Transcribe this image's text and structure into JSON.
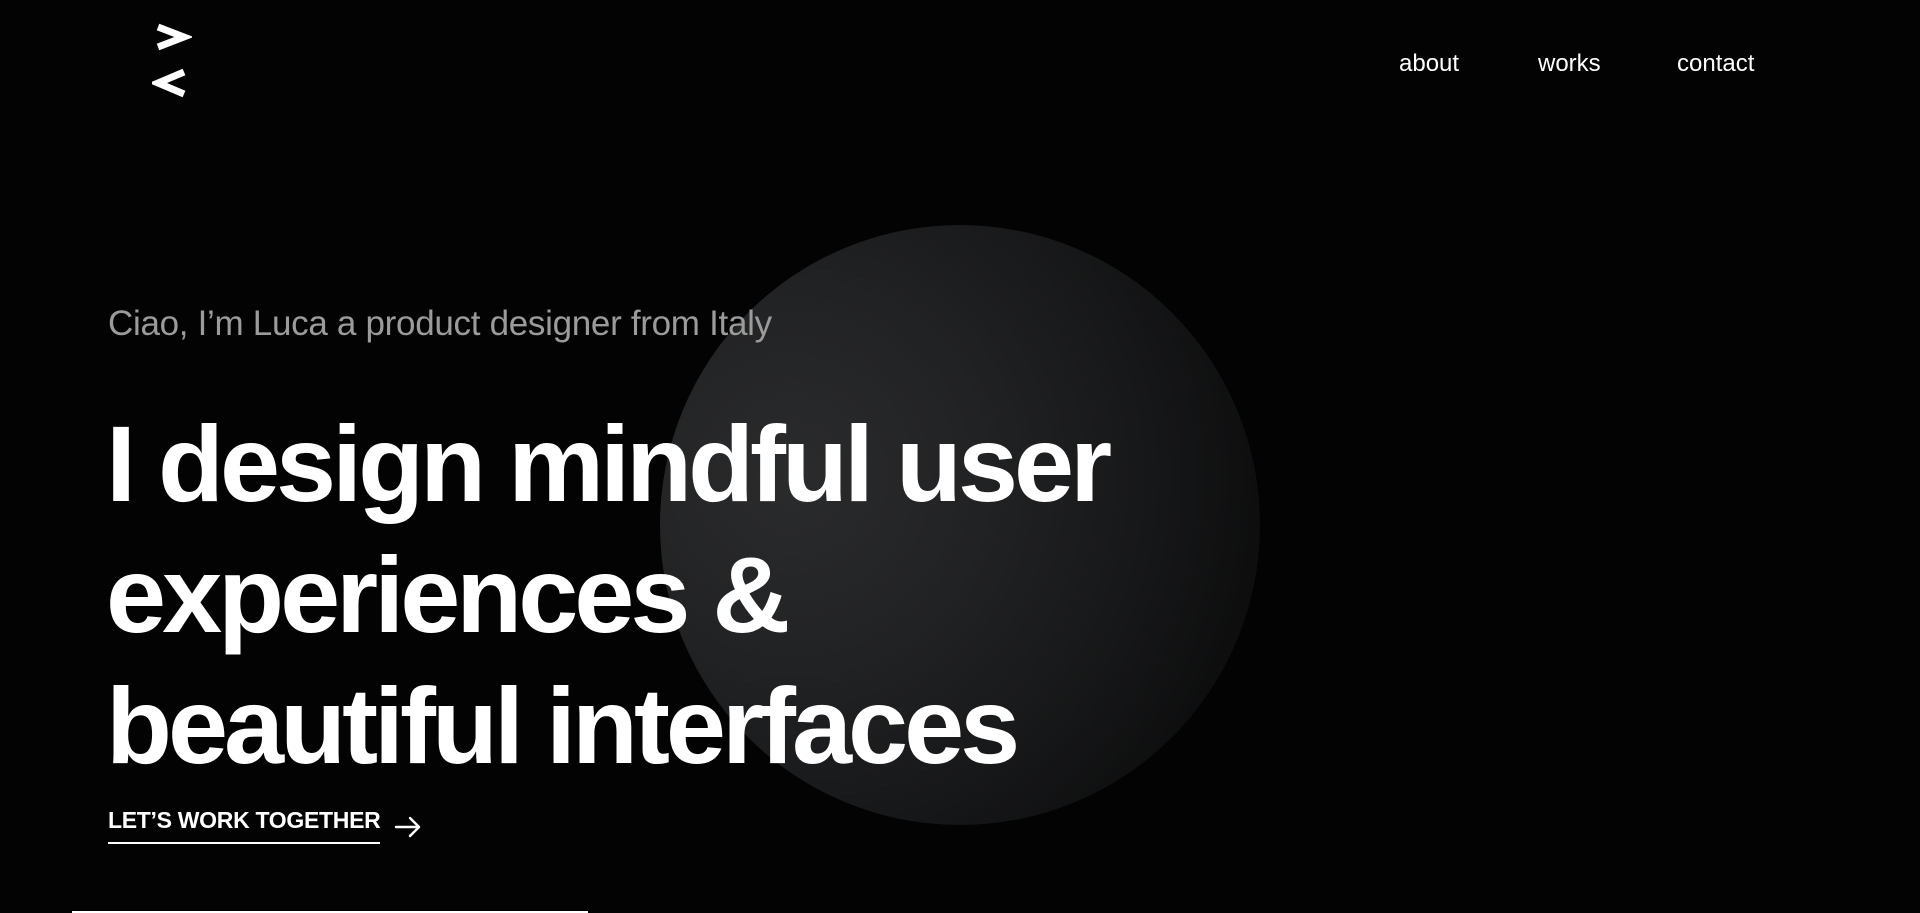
{
  "nav": {
    "about": "about",
    "works": "works",
    "contact": "contact"
  },
  "logo": {
    "icon": "chevron-logo-icon"
  },
  "hero": {
    "intro": "Ciao, I’m Luca a product designer from Italy",
    "headline_line1": "I design mindful user",
    "headline_line2": "experiences &",
    "headline_line3": "beautiful interfaces",
    "cta_label": "LET’S WORK TOGETHER",
    "cta_icon": "arrow-right-icon"
  },
  "colors": {
    "background": "#030303",
    "text": "#ffffff",
    "muted_text": "#9b9b9b",
    "orb_light": "#2a2b2d"
  }
}
